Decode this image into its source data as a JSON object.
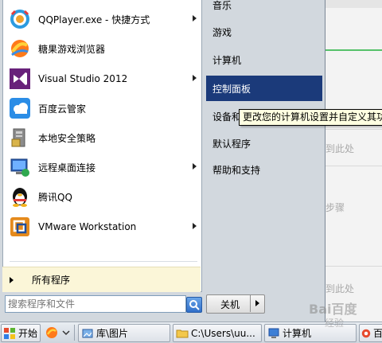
{
  "background_window": {
    "texts": [
      "到此处",
      "步骤",
      "到此处"
    ]
  },
  "start_menu": {
    "programs": [
      {
        "label": "QQPlayer.exe - 快捷方式",
        "icon": "qqplayer-icon",
        "has_submenu": true
      },
      {
        "label": "糖果游戏浏览器",
        "icon": "candy-browser-icon",
        "has_submenu": false
      },
      {
        "label": "Visual Studio 2012",
        "icon": "visual-studio-icon",
        "has_submenu": true
      },
      {
        "label": "百度云管家",
        "icon": "baidu-cloud-icon",
        "has_submenu": false
      },
      {
        "label": "本地安全策略",
        "icon": "security-policy-icon",
        "has_submenu": false
      },
      {
        "label": "远程桌面连接",
        "icon": "remote-desktop-icon",
        "has_submenu": true
      },
      {
        "label": "腾讯QQ",
        "icon": "qq-penguin-icon",
        "has_submenu": false
      },
      {
        "label": "VMware Workstation",
        "icon": "vmware-icon",
        "has_submenu": true
      }
    ],
    "all_programs_label": "所有程序",
    "search_placeholder": "搜索程序和文件",
    "right_items": [
      {
        "label": "音乐",
        "active": false
      },
      {
        "label": "游戏",
        "active": false
      },
      {
        "label": "计算机",
        "active": false
      },
      {
        "label": "控制面板",
        "active": true
      },
      {
        "label": "设备和",
        "active": false
      },
      {
        "label": "默认程序",
        "active": false
      },
      {
        "label": "帮助和支持",
        "active": false
      }
    ],
    "shutdown_label": "关机"
  },
  "tooltip": {
    "text": "更改您的计算机设置并自定义其功"
  },
  "taskbar": {
    "start_label": "开始",
    "tasks": [
      {
        "label": "库\\图片",
        "icon": "library-icon"
      },
      {
        "label": "C:\\Users\\uu...",
        "icon": "folder-icon"
      },
      {
        "label": "计算机",
        "icon": "computer-icon"
      },
      {
        "label": "百",
        "icon": "browser-icon"
      }
    ]
  },
  "watermark": {
    "text": "Bai百度",
    "sub": "经验"
  },
  "colors": {
    "highlight": "#1b3a7a",
    "tooltip_bg": "#ffffe1",
    "all_programs_bg": "#fbf6d8",
    "menu_bg": "#d2d8de"
  }
}
